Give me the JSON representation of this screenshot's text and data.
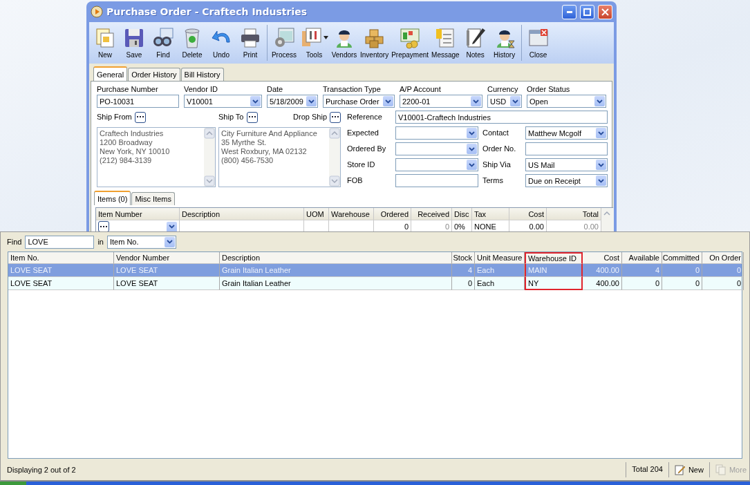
{
  "window": {
    "title": "Purchase Order - Craftech Industries"
  },
  "toolbar": {
    "groups": [
      [
        {
          "label": "New"
        },
        {
          "label": "Save"
        },
        {
          "label": "Find"
        },
        {
          "label": "Delete"
        },
        {
          "label": "Undo"
        },
        {
          "label": "Print"
        }
      ],
      [
        {
          "label": "Process"
        },
        {
          "label": "Tools",
          "has_menu": true
        },
        {
          "label": "Vendors"
        },
        {
          "label": "Inventory"
        },
        {
          "label": "Prepayment"
        },
        {
          "label": "Message"
        },
        {
          "label": "Notes"
        },
        {
          "label": "History"
        }
      ],
      [
        {
          "label": "Close"
        }
      ]
    ]
  },
  "tabs": [
    {
      "label": "General",
      "selected": true
    },
    {
      "label": "Order History",
      "selected": false
    },
    {
      "label": "Bill History",
      "selected": false
    }
  ],
  "header_fields": [
    {
      "label": "Purchase Number",
      "value": "PO-10031",
      "kind": "text"
    },
    {
      "label": "Vendor ID",
      "value": "V10001",
      "kind": "combo"
    },
    {
      "label": "Date",
      "value": "5/18/2009",
      "kind": "combo"
    },
    {
      "label": "Transaction Type",
      "value": "Purchase Order",
      "kind": "combo"
    },
    {
      "label": "A/P Account",
      "value": "2200-01",
      "kind": "combo"
    },
    {
      "label": "Currency",
      "value": "USD",
      "kind": "combo"
    },
    {
      "label": "Order Status",
      "value": "Open",
      "kind": "combo"
    }
  ],
  "addresses": [
    {
      "label": "Ship From",
      "lines": [
        "Craftech Industries",
        "1200 Broadway",
        "New York, NY 10010",
        "(212) 984-3139"
      ]
    },
    {
      "label": "Ship To",
      "lines": [
        "City Furniture And Appliance",
        "35 Myrthe St.",
        "West Roxbury, MA 02132",
        "(800) 456-7530"
      ]
    }
  ],
  "drop_ship": {
    "label": "Drop Ship"
  },
  "reference": {
    "label": "Reference",
    "value": "V10001-Craftech Industries"
  },
  "detail_rows": [
    [
      {
        "label": "Expected",
        "kind": "combo"
      },
      {
        "label": "Contact",
        "value": "Matthew Mcgolf",
        "kind": "combo"
      }
    ],
    [
      {
        "label": "Ordered By",
        "kind": "combo"
      },
      {
        "label": "Order No.",
        "kind": "text"
      }
    ],
    [
      {
        "label": "Store ID",
        "kind": "combo"
      },
      {
        "label": "Ship Via",
        "value": "US Mail",
        "kind": "combo"
      }
    ],
    [
      {
        "label": "FOB",
        "kind": "text"
      },
      {
        "label": "Terms",
        "value": "Due on Receipt",
        "kind": "combo"
      }
    ]
  ],
  "item_tabs": [
    {
      "label": "Items (0)",
      "selected": true
    },
    {
      "label": "Misc Items",
      "selected": false
    }
  ],
  "items_grid": {
    "columns": [
      {
        "label": "Item Number"
      },
      {
        "label": "Description"
      },
      {
        "label": "UOM"
      },
      {
        "label": "Warehouse"
      },
      {
        "label": "Ordered"
      },
      {
        "label": "Received"
      },
      {
        "label": "Disc"
      },
      {
        "label": "Tax"
      },
      {
        "label": "Cost"
      },
      {
        "label": "Total"
      }
    ],
    "row": {
      "ordered": "0",
      "received": "0",
      "disc": "0%",
      "tax": "NONE",
      "cost": "0.00",
      "total": "0.00"
    }
  },
  "lookup": {
    "find_label": "Find",
    "find_value": "LOVE",
    "in_label": "in",
    "in_field": "Item No.",
    "columns": [
      {
        "label": "Item No.",
        "highlighted": false
      },
      {
        "label": "Vendor Number",
        "highlighted": false
      },
      {
        "label": "Description",
        "highlighted": false
      },
      {
        "label": "Stock",
        "highlighted": false
      },
      {
        "label": "Unit Measure",
        "highlighted": false
      },
      {
        "label": "Warehouse ID",
        "highlighted": true
      },
      {
        "label": "Cost",
        "highlighted": false
      },
      {
        "label": "Available",
        "highlighted": false
      },
      {
        "label": "Committed",
        "highlighted": false
      },
      {
        "label": "On Order",
        "highlighted": false
      }
    ],
    "rows": [
      {
        "selected": true,
        "cells": [
          "LOVE SEAT",
          "LOVE SEAT",
          "Grain Italian Leather",
          "4",
          "Each",
          "MAIN",
          "400.00",
          "4",
          "0",
          "0"
        ]
      },
      {
        "selected": false,
        "cells": [
          "LOVE SEAT",
          "LOVE SEAT",
          "Grain Italian Leather",
          "0",
          "Each",
          "NY",
          "400.00",
          "0",
          "0",
          "0"
        ]
      }
    ]
  },
  "status_bar": {
    "text": "Displaying 2 out of 2",
    "total": "Total 204",
    "new_label": "New",
    "more_label": "More",
    "more_disabled": true
  }
}
